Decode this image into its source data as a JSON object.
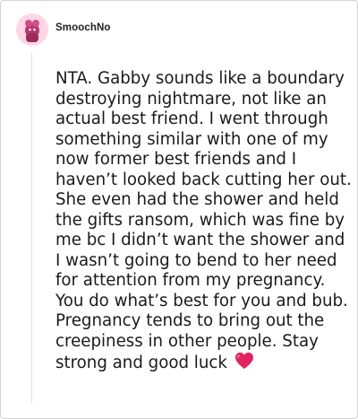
{
  "comment": {
    "username": "SmoochNo",
    "body": "NTA. Gabby sounds like a boundary destroying nightmare, not like an actual best friend. I went through something similar with one of my now former best friends and I haven’t looked back cutting her out. She even had the shower and held the gifts ransom, which was fine by me bc I didn’t want the shower and I wasn’t going to bend to her need for attention from my pregnancy. You do what’s best for you and bub. Pregnancy tends to bring out the creepiness in other people. Stay strong and good luck",
    "end_icon": "red-heart-icon"
  },
  "colors": {
    "avatar_background": "#ffd6e6",
    "avatar_figure": "#c2185b",
    "heart": "#e0245e",
    "thread_line": "#e2e2e2"
  }
}
